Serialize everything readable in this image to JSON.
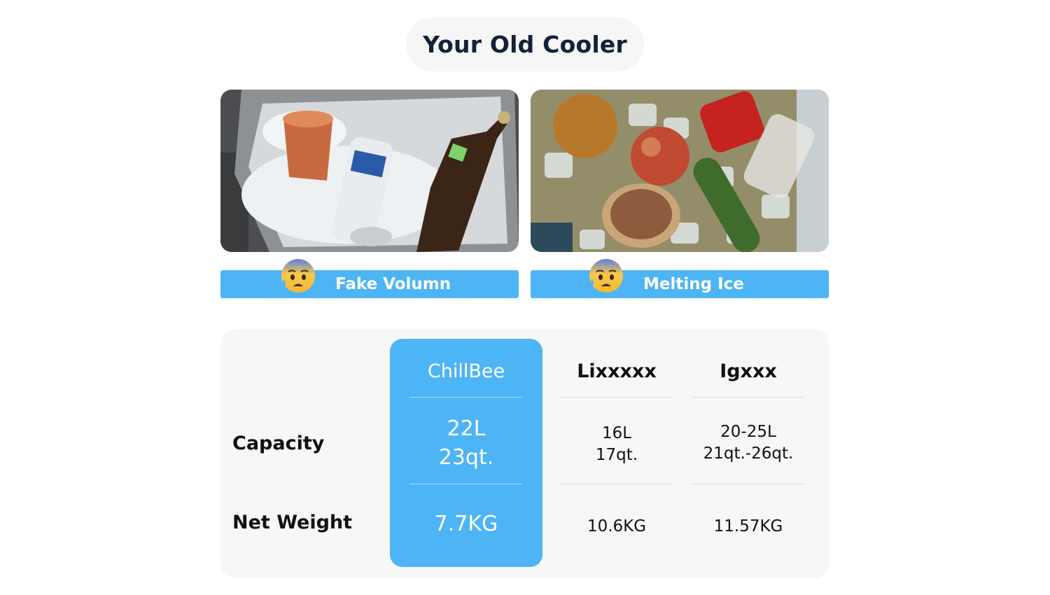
{
  "header": {
    "title": "Your Old Cooler"
  },
  "problems": [
    {
      "label": "Fake Volumn",
      "icon": "anxious-sweat-face-emoji"
    },
    {
      "label": "Melting Ice",
      "icon": "anxious-sweat-face-emoji"
    }
  ],
  "comparison": {
    "columns": [
      "ChillBee",
      "Lixxxxx",
      "Igxxx"
    ],
    "rows": [
      {
        "label": "Capacity",
        "values": [
          [
            "22L",
            "23qt."
          ],
          [
            "16L",
            "17qt."
          ],
          [
            "20-25L",
            "21qt.-26qt."
          ]
        ]
      },
      {
        "label": "Net Weight",
        "values": [
          "7.7KG",
          "10.6KG",
          "11.57KG"
        ]
      }
    ],
    "highlight_color": "#4db4f5"
  }
}
